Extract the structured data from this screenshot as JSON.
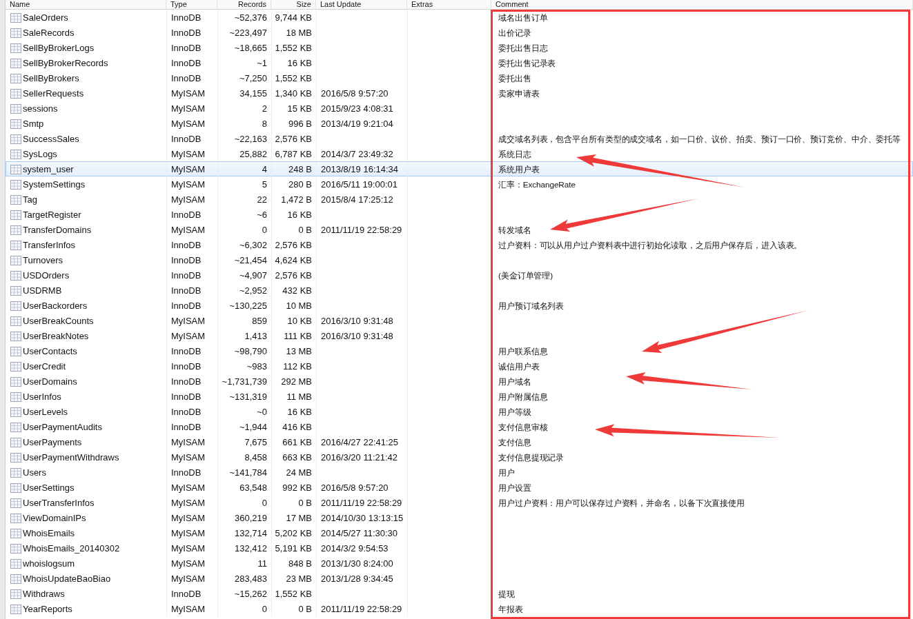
{
  "table": {
    "columns": [
      "Name",
      "Type",
      "Records",
      "Size",
      "Last Update",
      "Extras",
      "Comment"
    ],
    "rows": [
      {
        "name": "SaleOrders",
        "type": "InnoDB",
        "records": "~52,376",
        "size": "9,744 KB",
        "comment": "域名出售订单",
        "selected": false
      },
      {
        "name": "SaleRecords",
        "type": "InnoDB",
        "records": "~223,497",
        "size": "18 MB",
        "comment": "出价记录",
        "selected": false
      },
      {
        "name": "SellByBrokerLogs",
        "type": "InnoDB",
        "records": "~18,665",
        "size": "1,552 KB",
        "comment": "委托出售日志",
        "selected": false
      },
      {
        "name": "SellByBrokerRecords",
        "type": "InnoDB",
        "records": "~1",
        "size": "16 KB",
        "comment": "委托出售记录表",
        "selected": false
      },
      {
        "name": "SellByBrokers",
        "type": "InnoDB",
        "records": "~7,250",
        "size": "1,552 KB",
        "comment": "委托出售",
        "selected": false
      },
      {
        "name": "SellerRequests",
        "type": "MyISAM",
        "records": "34,155",
        "size": "1,340 KB",
        "updated": "2016/5/8 9:57:20",
        "comment": "卖家申请表",
        "selected": false
      },
      {
        "name": "sessions",
        "type": "MyISAM",
        "records": "2",
        "size": "15 KB",
        "updated": "2015/9/23 4:08:31",
        "selected": false
      },
      {
        "name": "Smtp",
        "type": "MyISAM",
        "records": "8",
        "size": "996 B",
        "updated": "2013/4/19 9:21:04",
        "selected": false
      },
      {
        "name": "SuccessSales",
        "type": "InnoDB",
        "records": "~22,163",
        "size": "2,576 KB",
        "comment": "成交域名列表，包含平台所有类型的成交域名，如一口价、议价、拍卖、预订一口价、预订竞价、中介、委托等",
        "selected": false
      },
      {
        "name": "SysLogs",
        "type": "MyISAM",
        "records": "25,882",
        "size": "6,787 KB",
        "updated": "2014/3/7 23:49:32",
        "comment": "系统日志",
        "selected": false
      },
      {
        "name": "system_user",
        "type": "MyISAM",
        "records": "4",
        "size": "248 B",
        "updated": "2013/8/19 16:14:34",
        "comment": "系统用户表",
        "selected": true
      },
      {
        "name": "SystemSettings",
        "type": "MyISAM",
        "records": "5",
        "size": "280 B",
        "updated": "2016/5/11 19:00:01",
        "comment": "汇率：ExchangeRate",
        "selected": false
      },
      {
        "name": "Tag",
        "type": "MyISAM",
        "records": "22",
        "size": "1,472 B",
        "updated": "2015/8/4 17:25:12",
        "selected": false
      },
      {
        "name": "TargetRegister",
        "type": "InnoDB",
        "records": "~6",
        "size": "16 KB",
        "selected": false
      },
      {
        "name": "TransferDomains",
        "type": "MyISAM",
        "records": "0",
        "size": "0 B",
        "updated": "2011/11/19 22:58:29",
        "comment": "转发域名",
        "selected": false
      },
      {
        "name": "TransferInfos",
        "type": "InnoDB",
        "records": "~6,302",
        "size": "2,576 KB",
        "comment": "过户资料：可以从用户过户资料表中进行初始化读取，之后用户保存后，进入该表。",
        "selected": false
      },
      {
        "name": "Turnovers",
        "type": "InnoDB",
        "records": "~21,454",
        "size": "4,624 KB",
        "selected": false
      },
      {
        "name": "USDOrders",
        "type": "InnoDB",
        "records": "~4,907",
        "size": "2,576 KB",
        "comment": "(美金订单管理)",
        "selected": false
      },
      {
        "name": "USDRMB",
        "type": "InnoDB",
        "records": "~2,952",
        "size": "432 KB",
        "selected": false
      },
      {
        "name": "UserBackorders",
        "type": "InnoDB",
        "records": "~130,225",
        "size": "10 MB",
        "comment": "用户预订域名列表",
        "selected": false
      },
      {
        "name": "UserBreakCounts",
        "type": "MyISAM",
        "records": "859",
        "size": "10 KB",
        "updated": "2016/3/10 9:31:48",
        "selected": false
      },
      {
        "name": "UserBreakNotes",
        "type": "MyISAM",
        "records": "1,413",
        "size": "111 KB",
        "updated": "2016/3/10 9:31:48",
        "selected": false
      },
      {
        "name": "UserContacts",
        "type": "InnoDB",
        "records": "~98,790",
        "size": "13 MB",
        "comment": "用户联系信息",
        "selected": false
      },
      {
        "name": "UserCredit",
        "type": "InnoDB",
        "records": "~983",
        "size": "112 KB",
        "comment": "诚信用户表",
        "selected": false
      },
      {
        "name": "UserDomains",
        "type": "InnoDB",
        "records": "~1,731,739",
        "size": "292 MB",
        "comment": "用户域名",
        "selected": false
      },
      {
        "name": "UserInfos",
        "type": "InnoDB",
        "records": "~131,319",
        "size": "11 MB",
        "comment": "用户附属信息",
        "selected": false
      },
      {
        "name": "UserLevels",
        "type": "InnoDB",
        "records": "~0",
        "size": "16 KB",
        "comment": "用户等级",
        "selected": false
      },
      {
        "name": "UserPaymentAudits",
        "type": "InnoDB",
        "records": "~1,944",
        "size": "416 KB",
        "comment": "支付信息审核",
        "selected": false
      },
      {
        "name": "UserPayments",
        "type": "MyISAM",
        "records": "7,675",
        "size": "661 KB",
        "updated": "2016/4/27 22:41:25",
        "comment": "支付信息",
        "selected": false
      },
      {
        "name": "UserPaymentWithdraws",
        "type": "MyISAM",
        "records": "8,458",
        "size": "663 KB",
        "updated": "2016/3/20 11:21:42",
        "comment": "支付信息提现记录",
        "selected": false
      },
      {
        "name": "Users",
        "type": "InnoDB",
        "records": "~141,784",
        "size": "24 MB",
        "comment": "用户",
        "selected": false
      },
      {
        "name": "UserSettings",
        "type": "MyISAM",
        "records": "63,548",
        "size": "992 KB",
        "updated": "2016/5/8 9:57:20",
        "comment": "用户设置",
        "selected": false
      },
      {
        "name": "UserTransferInfos",
        "type": "MyISAM",
        "records": "0",
        "size": "0 B",
        "updated": "2011/11/19 22:58:29",
        "comment": "用户过户资料：用户可以保存过户资料，并命名，以备下次直接使用",
        "selected": false
      },
      {
        "name": "ViewDomainIPs",
        "type": "MyISAM",
        "records": "360,219",
        "size": "17 MB",
        "updated": "2014/10/30 13:13:15",
        "selected": false
      },
      {
        "name": "WhoisEmails",
        "type": "MyISAM",
        "records": "132,714",
        "size": "5,202 KB",
        "updated": "2014/5/27 11:30:30",
        "selected": false
      },
      {
        "name": "WhoisEmails_20140302",
        "type": "MyISAM",
        "records": "132,412",
        "size": "5,191 KB",
        "updated": "2014/3/2 9:54:53",
        "selected": false
      },
      {
        "name": "whoislogsum",
        "type": "MyISAM",
        "records": "11",
        "size": "848 B",
        "updated": "2013/1/30 8:24:00",
        "selected": false
      },
      {
        "name": "WhoisUpdateBaoBiao",
        "type": "MyISAM",
        "records": "283,483",
        "size": "23 MB",
        "updated": "2013/1/28 9:34:45",
        "selected": false
      },
      {
        "name": "Withdraws",
        "type": "InnoDB",
        "records": "~15,262",
        "size": "1,552 KB",
        "comment": "提现",
        "selected": false
      },
      {
        "name": "YearReports",
        "type": "MyISAM",
        "records": "0",
        "size": "0 B",
        "updated": "2011/11/19 22:58:29",
        "comment": "年报表",
        "selected": false
      }
    ]
  }
}
